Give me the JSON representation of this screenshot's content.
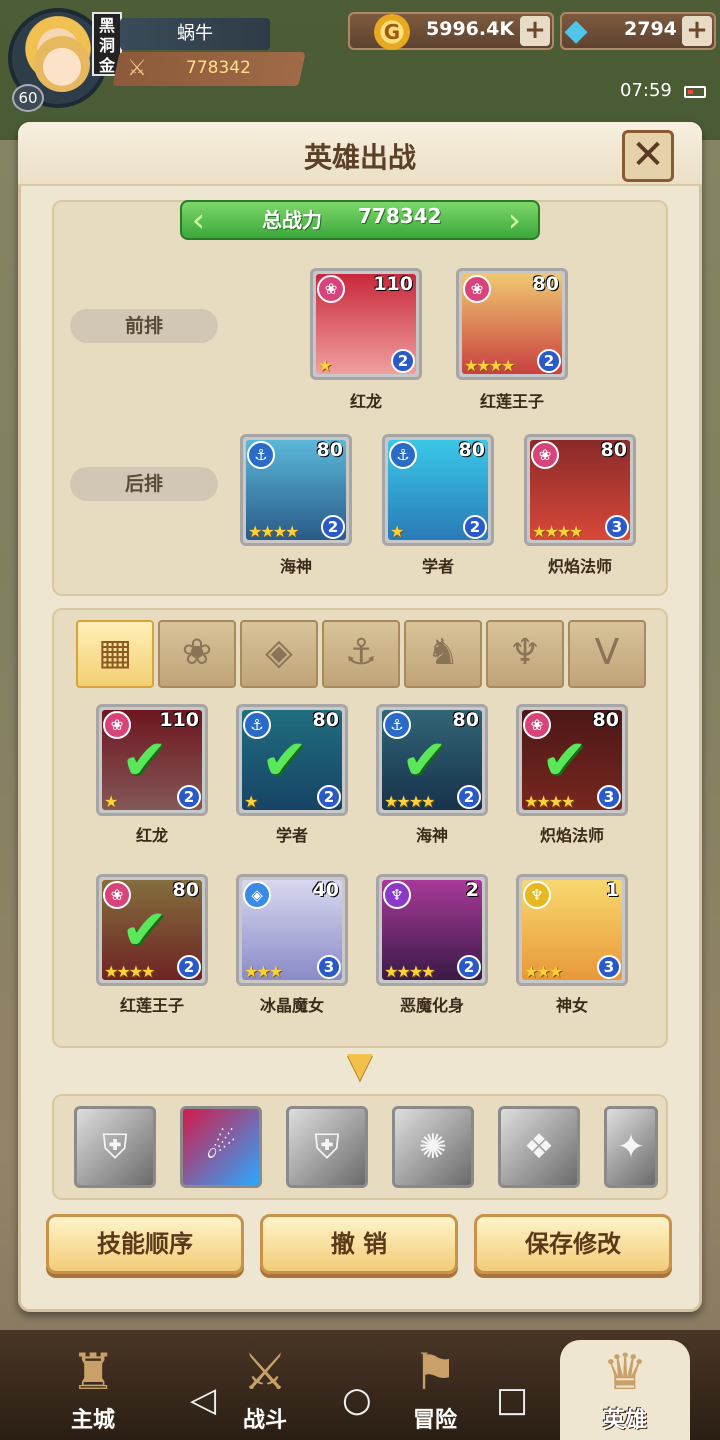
{
  "player": {
    "name": "蜗牛",
    "level": "60",
    "guild": "黑洞金",
    "power": "778342"
  },
  "resources": {
    "gold": "5996.4K",
    "gems": "2794"
  },
  "status": {
    "time": "07:59"
  },
  "dialog": {
    "title": "英雄出战",
    "total_power_label": "总战力",
    "total_power_value": "778342",
    "front_row_label": "前排",
    "back_row_label": "后排"
  },
  "front_row": [
    {
      "name": "红龙",
      "level": "110",
      "stage": "2",
      "stars": "★",
      "faction": "❀",
      "faction_color": "#d8447a"
    },
    {
      "name": "红莲王子",
      "level": "80",
      "stage": "2",
      "stars": "★★★★",
      "faction": "❀",
      "faction_color": "#d8447a"
    }
  ],
  "back_row": [
    {
      "name": "海神",
      "level": "80",
      "stage": "2",
      "stars": "★★★★",
      "faction": "⚓",
      "faction_color": "#2a6ac8"
    },
    {
      "name": "学者",
      "level": "80",
      "stage": "2",
      "stars": "★",
      "faction": "⚓",
      "faction_color": "#2a6ac8"
    },
    {
      "name": "炽焰法师",
      "level": "80",
      "stage": "3",
      "stars": "★★★★",
      "faction": "❀",
      "faction_color": "#d8447a"
    }
  ],
  "roster": [
    {
      "name": "红龙",
      "level": "110",
      "stage": "2",
      "stars": "★",
      "faction": "❀",
      "faction_color": "#d8447a",
      "selected": true
    },
    {
      "name": "学者",
      "level": "80",
      "stage": "2",
      "stars": "★",
      "faction": "⚓",
      "faction_color": "#2a6ac8",
      "selected": true
    },
    {
      "name": "海神",
      "level": "80",
      "stage": "2",
      "stars": "★★★★",
      "faction": "⚓",
      "faction_color": "#2a6ac8",
      "selected": true
    },
    {
      "name": "炽焰法师",
      "level": "80",
      "stage": "3",
      "stars": "★★★★",
      "faction": "❀",
      "faction_color": "#d8447a",
      "selected": true
    },
    {
      "name": "红莲王子",
      "level": "80",
      "stage": "2",
      "stars": "★★★★",
      "faction": "❀",
      "faction_color": "#d8447a",
      "selected": true
    },
    {
      "name": "冰晶魔女",
      "level": "40",
      "stage": "3",
      "stars": "★★★",
      "faction": "◈",
      "faction_color": "#3a8ae8",
      "selected": false
    },
    {
      "name": "恶魔化身",
      "level": "2",
      "stage": "2",
      "stars": "★★★★",
      "faction": "♆",
      "faction_color": "#8a3ac8",
      "selected": false
    },
    {
      "name": "神女",
      "level": "1",
      "stage": "3",
      "stars": "★★★",
      "faction": "♆",
      "faction_color": "#e8b820",
      "selected": false
    }
  ],
  "filter_tabs": [
    {
      "icon": "grid-icon",
      "glyph": "▦",
      "active": true
    },
    {
      "icon": "flower-icon",
      "glyph": "❀",
      "active": false
    },
    {
      "icon": "diamond-icon",
      "glyph": "◈",
      "active": false
    },
    {
      "icon": "anchor-icon",
      "glyph": "⚓",
      "active": false
    },
    {
      "icon": "beast-icon",
      "glyph": "♞",
      "active": false
    },
    {
      "icon": "demon-icon",
      "glyph": "♆",
      "active": false
    },
    {
      "icon": "wing-icon",
      "glyph": "V",
      "active": false
    }
  ],
  "skills": [
    {
      "icon": "shield-skill-icon",
      "glyph": "⛨"
    },
    {
      "icon": "water-skill-icon",
      "glyph": "☄"
    },
    {
      "icon": "shield-skill-icon",
      "glyph": "⛨"
    },
    {
      "icon": "vortex-skill-icon",
      "glyph": "✺"
    },
    {
      "icon": "crystal-skill-icon",
      "glyph": "❖"
    },
    {
      "icon": "dark-skill-icon",
      "glyph": "✦"
    }
  ],
  "buttons": {
    "skill_order": "技能顺序",
    "undo": "撤 销",
    "save": "保存修改"
  },
  "nav": [
    {
      "label": "主城",
      "icon": "castle-icon",
      "glyph": "♜"
    },
    {
      "label": "战斗",
      "icon": "swords-icon",
      "glyph": "⚔"
    },
    {
      "label": "冒险",
      "icon": "map-icon",
      "glyph": "⚑"
    },
    {
      "label": "英雄",
      "icon": "hero-crest-icon",
      "glyph": "♛"
    }
  ]
}
